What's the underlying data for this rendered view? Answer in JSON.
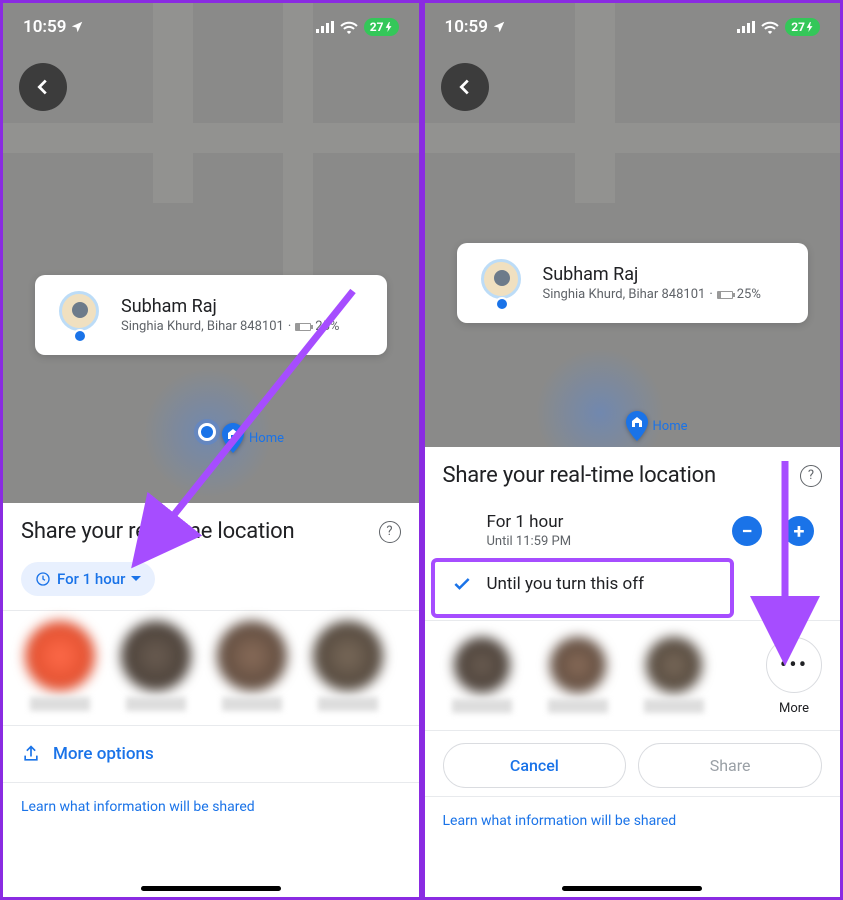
{
  "status": {
    "time": "10:59",
    "battery": "27"
  },
  "person": {
    "name": "Subham Raj",
    "address": "Singhia Khurd, Bihar 848101",
    "battery_pct": "25%"
  },
  "map": {
    "home_label": "Home"
  },
  "sheet": {
    "title": "Share your real-time location",
    "for_1_hour": "For 1 hour",
    "until_caption": "Until 11:59 PM",
    "until_off": "Until you turn this off",
    "more_options": "More options",
    "learn": "Learn what information will be shared",
    "more": "More",
    "cancel": "Cancel",
    "share": "Share"
  },
  "colors": {
    "accent": "#1a73e8",
    "annotation": "#a64dff",
    "battery_green": "#34c759"
  }
}
